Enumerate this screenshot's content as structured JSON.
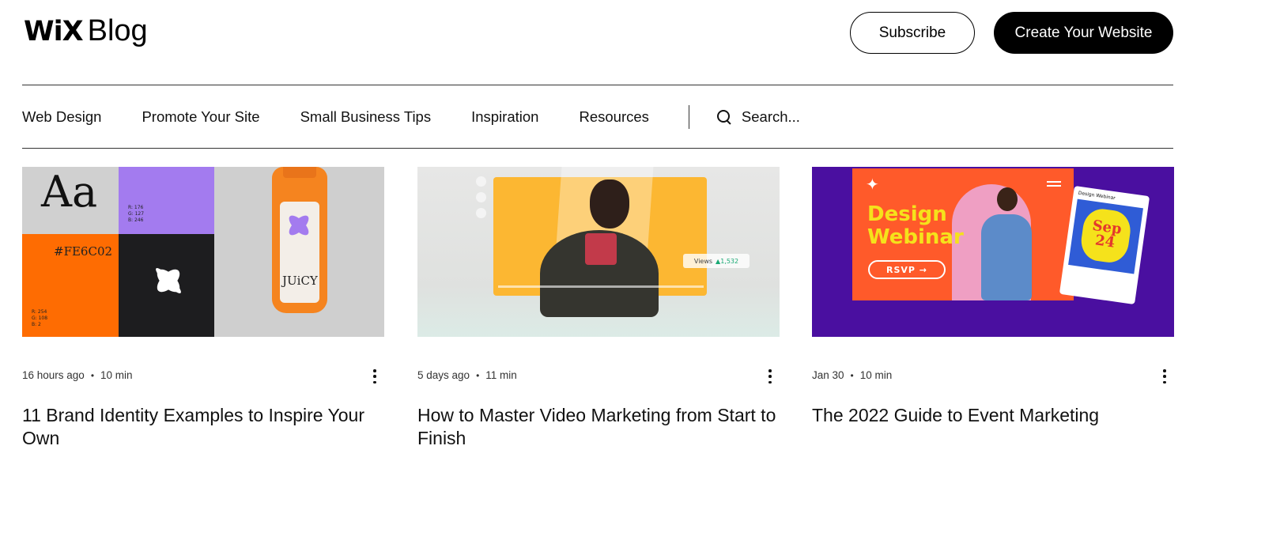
{
  "header": {
    "logo_wix": "WiX",
    "logo_blog": "Blog",
    "subscribe_label": "Subscribe",
    "create_label": "Create Your Website"
  },
  "nav": {
    "items": [
      {
        "label": "Web Design"
      },
      {
        "label": "Promote Your Site"
      },
      {
        "label": "Small Business Tips"
      },
      {
        "label": "Inspiration"
      },
      {
        "label": "Resources"
      }
    ],
    "search_placeholder": "Search..."
  },
  "posts": [
    {
      "time": "16 hours ago",
      "read": "10 min",
      "title": "11 Brand Identity Examples to Inspire Your Own",
      "image": {
        "aa": "Aa",
        "hex": "#FE6C02",
        "rgb_purple": [
          "R: 176",
          "G: 127",
          "B: 246"
        ],
        "rgb_orange": [
          "R: 254",
          "G: 108",
          "B: 2"
        ],
        "bottle_label": "JUiCY"
      }
    },
    {
      "time": "5 days ago",
      "read": "11 min",
      "title": "How to Master Video Marketing from Start to Finish",
      "image": {
        "views_label": "Views",
        "views_value": "▲1,532"
      }
    },
    {
      "time": "Jan 30",
      "read": "10 min",
      "title": "The 2022 Guide to Event Marketing",
      "image": {
        "headline_1": "Design",
        "headline_2": "Webinar",
        "rsvp": "RSVP →",
        "card_title": "Design Webinar",
        "date_1": "Sep",
        "date_2": "24"
      }
    }
  ],
  "colors": {
    "purple": "#a37bef",
    "orange": "#fe6c02",
    "dark": "#1d1d1f",
    "webinar_bg": "#4a0fa0",
    "webinar_poster": "#ff5a2a",
    "yellow": "#f5e21b"
  }
}
